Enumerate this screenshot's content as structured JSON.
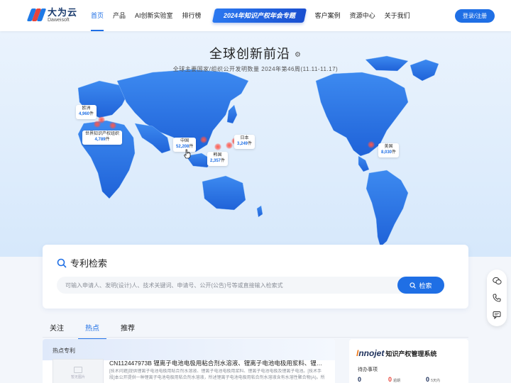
{
  "header": {
    "logo_cn": "大为云",
    "logo_en": "Daweisoft",
    "nav": [
      "首页",
      "产品",
      "AI创新实验室",
      "排行榜"
    ],
    "banner": "2024年知识产权年会专题",
    "nav_right": [
      "客户案例",
      "资源中心",
      "关于我们"
    ],
    "login": "登录/注册",
    "brand_colors": {
      "primary": "#1f6fe5",
      "logo_red": "#e8443a"
    }
  },
  "hero": {
    "title": "全球创新前沿",
    "title_icon": "gear-icon",
    "subtitle": "全球主要国家/组织公开发明数量 2024年第46周(11.11-11.17)",
    "regions": [
      {
        "name": "欧洲",
        "count": "4,960",
        "unit": "件"
      },
      {
        "name": "世界知识产权组织",
        "count": "4,789",
        "unit": "件"
      },
      {
        "name": "中国",
        "count": "52,208",
        "unit": "件"
      },
      {
        "name": "日本",
        "count": "3,249",
        "unit": "件"
      },
      {
        "name": "韩国",
        "count": "2,357",
        "unit": "件"
      },
      {
        "name": "美国",
        "count": "8,030",
        "unit": "件"
      }
    ]
  },
  "search": {
    "title": "专利检索",
    "placeholder": "可输入申请人、发明(设计)人、技术关键词、申请号、公开(公告)号等或直接输入检索式",
    "button": "检索"
  },
  "tabs": [
    "关注",
    "热点",
    "推荐"
  ],
  "hot": {
    "title": "热点专利",
    "thumb_text": "暂无图片",
    "patent_title": "CN112447973B 锂离子电池电极用粘合剂水溶液、锂离子电池电极用浆料、锂离子电...",
    "patent_abstract": "[技术问题]提供锂离子电池电极用粘合剂水溶液、锂离子电池电极用浆料、锂离子电池电极及锂离子电池。[技术手段]本公开提供一种锂离子电池电极用粘合剂水溶液，所述锂离子电池电极用粘合剂水溶液含有水溶性聚合物(A)。所"
  },
  "system": {
    "brand_prefix": "I",
    "brand_rest": "nnojet",
    "name": "知识产权管理系统",
    "todo": "待办事项",
    "stats": [
      {
        "num": "0",
        "label": ""
      },
      {
        "num": "0",
        "label": "逾期"
      },
      {
        "num": "0",
        "label": "5天内"
      }
    ]
  },
  "float_icons": [
    "wechat-icon",
    "phone-icon",
    "chat-icon"
  ]
}
